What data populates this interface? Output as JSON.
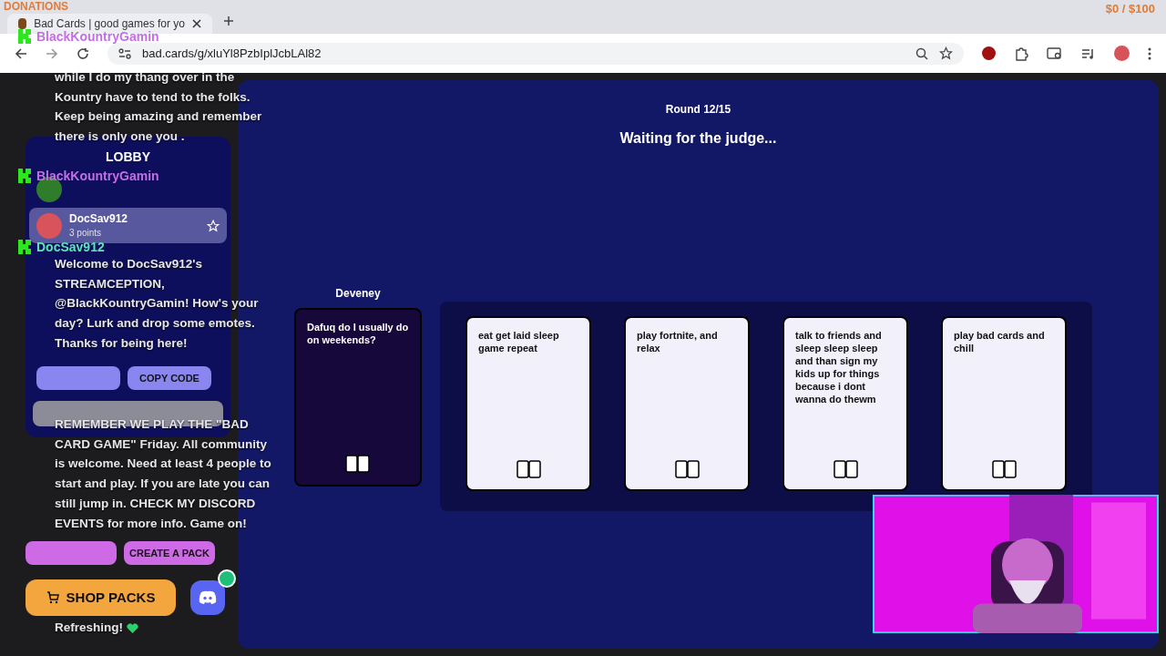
{
  "overlay": {
    "donations_label": "DONATIONS",
    "donations_amount": "$0 / $100"
  },
  "browser": {
    "tab_title": "Bad Cards | good games for yo",
    "url": "bad.cards/g/xluYl8PzbIplJcbLAl82"
  },
  "lobby": {
    "title": "LOBBY",
    "current_player": {
      "name": "DocSav912",
      "points": "3 points"
    },
    "copy_code": "COPY CODE",
    "create_pack": "CREATE A PACK",
    "shop": "SHOP PACKS"
  },
  "game": {
    "round": "Round 12/15",
    "status": "Waiting for the judge...",
    "judge": "Deveney",
    "prompt": "Dafuq do I usually do on weekends?",
    "answers": [
      "eat get laid sleep game repeat",
      "play fortnite, and relax",
      "talk to friends and sleep sleep sleep and than sign my kids up for things because i dont wanna do thewm",
      "play bad cards and chill"
    ]
  },
  "chat": [
    {
      "user": "BlackKountryGamin",
      "color": "#c46ee6",
      "text": "while I do my thang over in the Kountry have to tend to the folks. Keep being amazing and remember there is only one you ."
    },
    {
      "user": "BlackKountryGamin",
      "color": "#c46ee6"
    },
    {
      "user": "DocSav912",
      "color": "#5fe3b5",
      "text": "Welcome to DocSav912's STREAMCEPTION, @BlackKountryGamin! How's your day? Lurk and drop some emotes. Thanks for being here!"
    },
    {
      "text": "REMEMBER WE PLAY THE \"BAD CARD GAME\" Friday. All community is welcome. Need at least 4 people to start and play. If you are late you can still jump in. CHECK MY DISCORD EVENTS for more info. Game on!"
    },
    {
      "text": "Refreshing!",
      "heart": true
    }
  ]
}
